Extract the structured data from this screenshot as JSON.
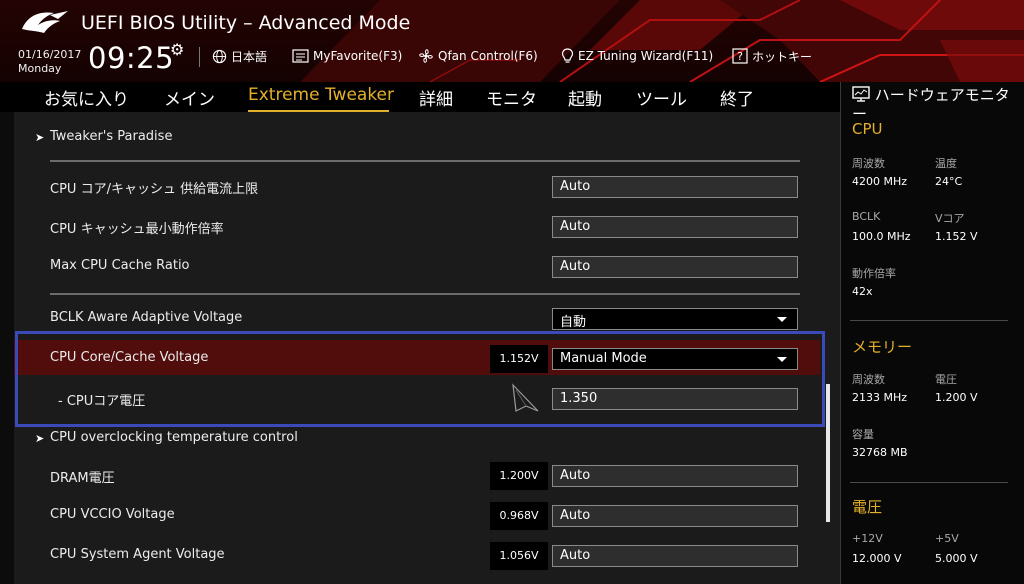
{
  "header": {
    "title": "UEFI BIOS Utility – Advanced Mode",
    "date": "01/16/2017",
    "day": "Monday",
    "time": "09:25",
    "buttons": [
      {
        "label": "日本語",
        "icon": "globe-icon"
      },
      {
        "label": "MyFavorite(F3)",
        "icon": "favorite-list-icon"
      },
      {
        "label": "Qfan Control(F6)",
        "icon": "fan-icon"
      },
      {
        "label": "EZ Tuning Wizard(F11)",
        "icon": "lightbulb-icon"
      },
      {
        "label": "ホットキー",
        "icon": "help-icon"
      }
    ]
  },
  "menu": {
    "tabs": [
      "お気に入り",
      "メイン",
      "Extreme Tweaker",
      "詳細",
      "モニタ",
      "起動",
      "ツール",
      "終了"
    ],
    "active_tab": "Extreme Tweaker"
  },
  "settings": {
    "tweakers_paradise": "Tweaker's Paradise",
    "cpu_core_cache_current_limit": {
      "label": "CPU コア/キャッシュ 供給電流上限",
      "value": "Auto"
    },
    "cpu_cache_min_ratio": {
      "label": "CPU キャッシュ最小動作倍率",
      "value": "Auto"
    },
    "max_cpu_cache_ratio": {
      "label": "Max CPU Cache Ratio",
      "value": "Auto"
    },
    "bclk_aware_adaptive_voltage": {
      "label": "BCLK Aware Adaptive Voltage",
      "value": "自動"
    },
    "cpu_core_cache_voltage": {
      "label": "CPU Core/Cache Voltage",
      "current": "1.152V",
      "value": "Manual Mode"
    },
    "cpu_core_voltage": {
      "label": "- CPUコア電圧",
      "value": "1.350"
    },
    "cpu_oc_temp_control": "CPU overclocking temperature control",
    "dram_voltage": {
      "label": "DRAM電圧",
      "current": "1.200V",
      "value": "Auto"
    },
    "cpu_vccio_voltage": {
      "label": "CPU VCCIO Voltage",
      "current": "0.968V",
      "value": "Auto"
    },
    "cpu_system_agent_voltage": {
      "label": "CPU System Agent Voltage",
      "current": "1.056V",
      "value": "Auto"
    }
  },
  "hardware_monitor": {
    "title": "ハードウェアモニター",
    "cpu": {
      "section": "CPU",
      "frequency_label": "周波数",
      "frequency": "4200 MHz",
      "temperature_label": "温度",
      "temperature": "24°C",
      "bclk_label": "BCLK",
      "bclk": "100.0 MHz",
      "vcore_label": "Vコア",
      "vcore": "1.152 V",
      "ratio_label": "動作倍率",
      "ratio": "42x"
    },
    "memory": {
      "section": "メモリー",
      "frequency_label": "周波数",
      "frequency": "2133 MHz",
      "voltage_label": "電圧",
      "voltage": "1.200 V",
      "capacity_label": "容量",
      "capacity": "32768 MB"
    },
    "voltage": {
      "section": "電圧",
      "v12_label": "+12V",
      "v12": "12.000 V",
      "v5_label": "+5V",
      "v5": "5.000 V"
    }
  },
  "colors": {
    "accent": "#e3b02c",
    "selected_row": "#510c0c",
    "selection_outline": "#3a4ab8",
    "header_red": "#c01010"
  }
}
